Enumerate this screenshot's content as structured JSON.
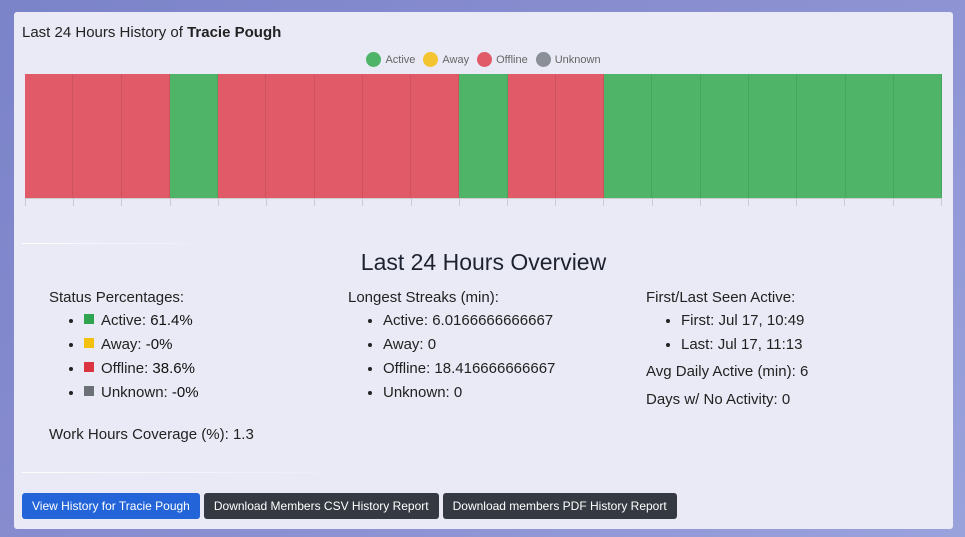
{
  "title": {
    "prefix": "Last 24 Hours History of",
    "user": "Tracie Pough"
  },
  "legend": [
    {
      "label": "Active",
      "color": "#4fb468"
    },
    {
      "label": "Away",
      "color": "#f4c430"
    },
    {
      "label": "Offline",
      "color": "#e05a68"
    },
    {
      "label": "Unknown",
      "color": "#8a8f98"
    }
  ],
  "chart_data": {
    "type": "bar",
    "title": "",
    "segments": [
      "Offline",
      "Offline",
      "Offline",
      "Active",
      "Offline",
      "Offline",
      "Offline",
      "Offline",
      "Offline",
      "Active",
      "Offline",
      "Offline",
      "Active",
      "Active",
      "Active",
      "Active",
      "Active",
      "Active",
      "Active"
    ]
  },
  "overview": {
    "title": "Last 24 Hours Overview",
    "status_percentages": {
      "heading": "Status Percentages:",
      "items": [
        {
          "label": "Active:",
          "value": "61.4%",
          "color": "#2ea44f"
        },
        {
          "label": "Away:",
          "value": "-0%",
          "color": "#f4c010"
        },
        {
          "label": "Offline:",
          "value": "38.6%",
          "color": "#d9343f"
        },
        {
          "label": "Unknown:",
          "value": "-0%",
          "color": "#6b6f76"
        }
      ]
    },
    "longest_streaks": {
      "heading": "Longest Streaks (min):",
      "items": [
        {
          "label": "Active:",
          "value": "6.0166666666667"
        },
        {
          "label": "Away:",
          "value": "0"
        },
        {
          "label": "Offline:",
          "value": "18.416666666667"
        },
        {
          "label": "Unknown:",
          "value": "0"
        }
      ]
    },
    "first_last": {
      "heading": "First/Last Seen Active:",
      "items": [
        {
          "label": "First:",
          "value": "Jul 17, 10:49"
        },
        {
          "label": "Last:",
          "value": "Jul 17, 11:13"
        }
      ]
    },
    "avg_daily_active": {
      "label": "Avg Daily Active (min):",
      "value": "6"
    },
    "days_no_activity": {
      "label": "Days w/ No Activity:",
      "value": "0"
    },
    "work_hours": {
      "label": "Work Hours Coverage (%):",
      "value": "1.3"
    }
  },
  "buttons": {
    "view_history": "View History for Tracie Pough",
    "csv": "Download Members CSV History Report",
    "pdf": "Download members PDF History Report"
  }
}
